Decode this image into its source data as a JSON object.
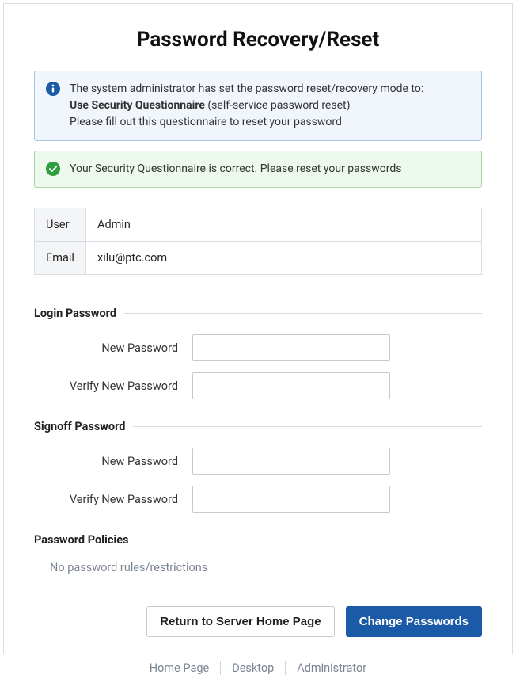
{
  "title": "Password Recovery/Reset",
  "info_alert": {
    "line1": "The system administrator has set the password reset/recovery mode to:",
    "bold": "Use Security Questionnaire",
    "after_bold": " (self-service password reset)",
    "line3": "Please fill out this questionnaire to reset your password"
  },
  "success_alert": {
    "text": "Your Security Questionnaire is correct. Please reset your passwords"
  },
  "user_info": {
    "user_label": "User",
    "user_value": "Admin",
    "email_label": "Email",
    "email_value": "xilu@ptc.com"
  },
  "login_section": {
    "legend": "Login Password",
    "new_label": "New Password",
    "verify_label": "Verify New Password",
    "new_value": "",
    "verify_value": ""
  },
  "signoff_section": {
    "legend": "Signoff Password",
    "new_label": "New Password",
    "verify_label": "Verify New Password",
    "new_value": "",
    "verify_value": ""
  },
  "policies_section": {
    "legend": "Password Policies",
    "text": "No password rules/restrictions"
  },
  "buttons": {
    "return": "Return to Server Home Page",
    "change": "Change Passwords"
  },
  "footer": {
    "home": "Home Page",
    "desktop": "Desktop",
    "admin": "Administrator"
  }
}
